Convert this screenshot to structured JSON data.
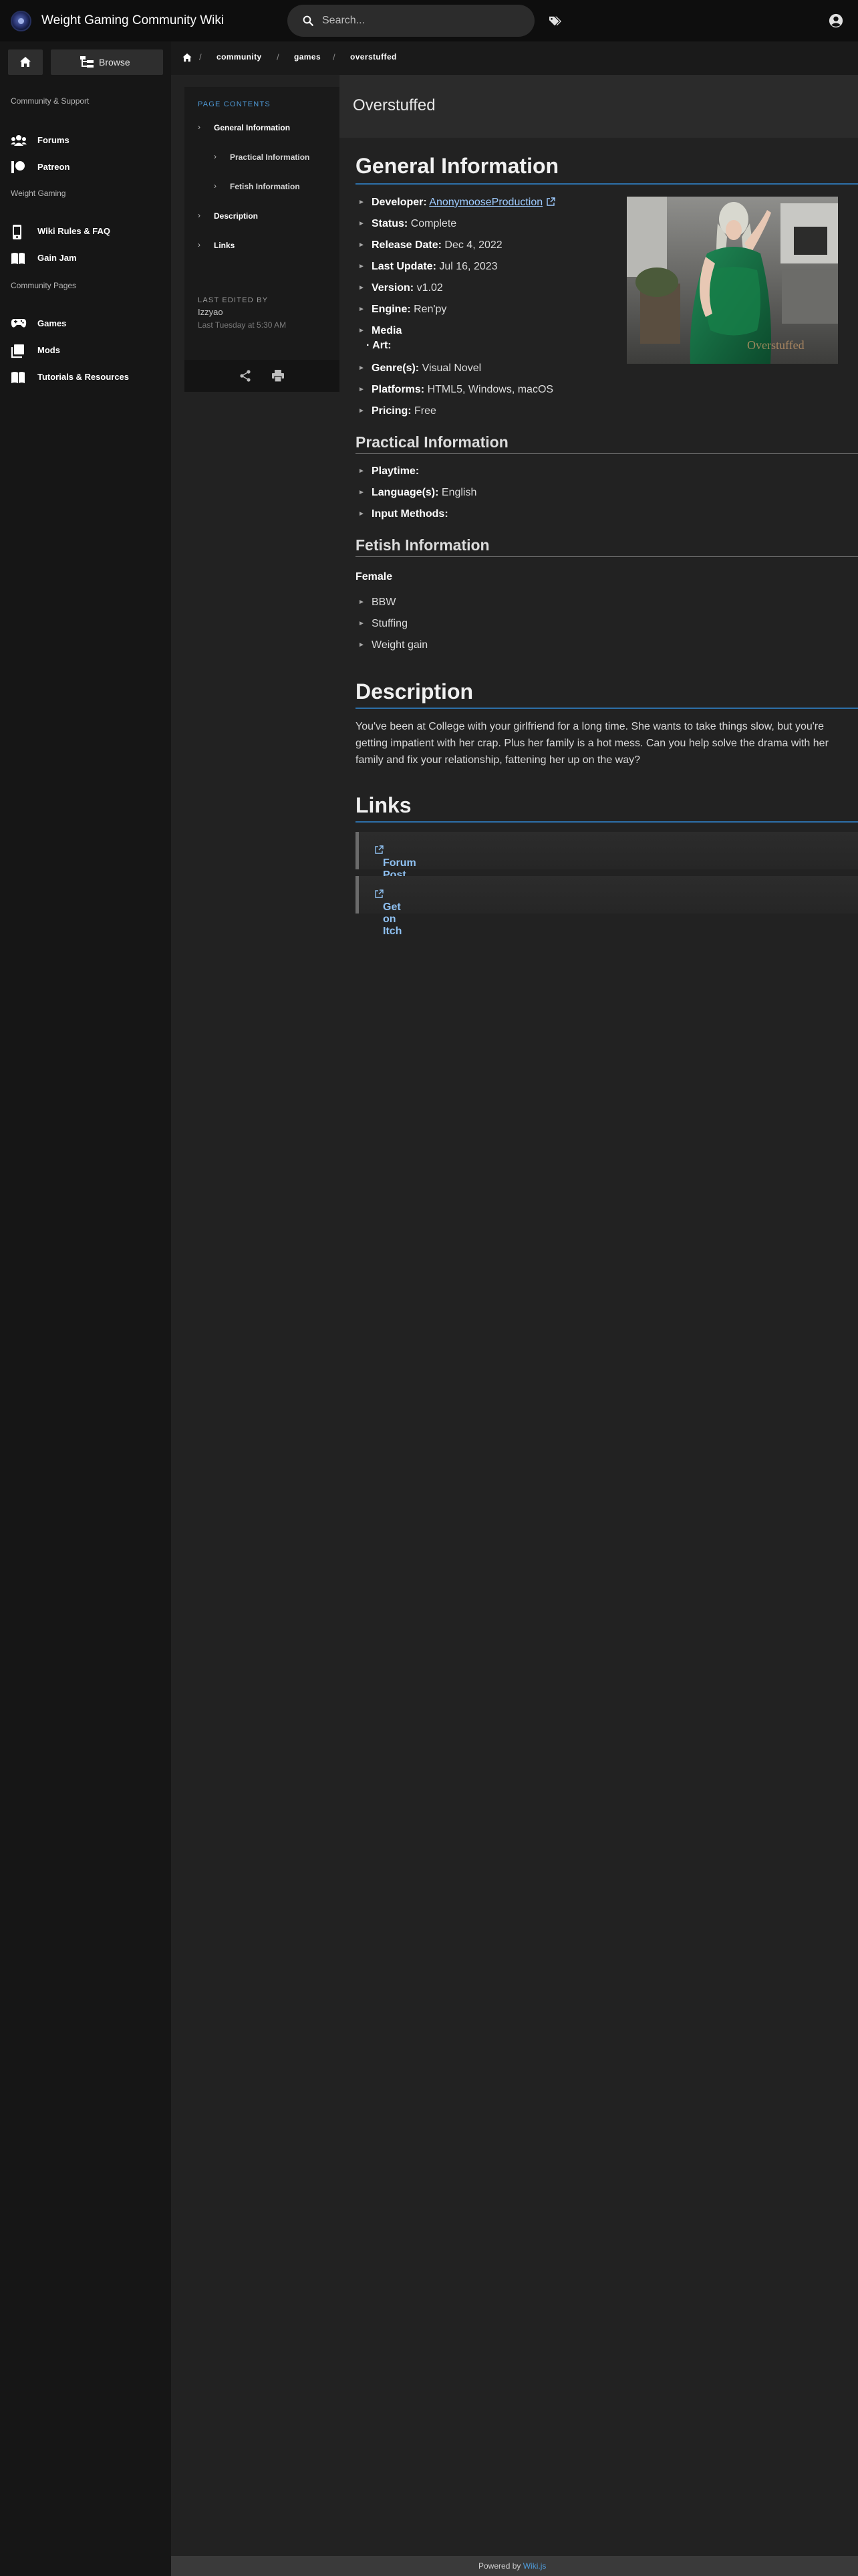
{
  "header": {
    "site_title": "Weight Gaming Community Wiki",
    "search_placeholder": "Search..."
  },
  "sidebar": {
    "browse_label": "Browse",
    "section_community": "Community & Support",
    "forums": "Forums",
    "patreon": "Patreon",
    "section_weight_gaming": "Weight Gaming",
    "rules": "Wiki Rules & FAQ",
    "gain_jam": "Gain Jam",
    "section_pages": "Community Pages",
    "games": "Games",
    "mods": "Mods",
    "tutorials": "Tutorials & Resources"
  },
  "breadcrumb": [
    "community",
    "games",
    "overstuffed"
  ],
  "page": {
    "title": "Overstuffed"
  },
  "toc": {
    "header": "PAGE CONTENTS",
    "items": [
      {
        "label": "General Information"
      },
      {
        "label": "Practical Information"
      },
      {
        "label": "Fetish Information"
      },
      {
        "label": "Description"
      },
      {
        "label": "Links"
      }
    ],
    "edited_header": "LAST EDITED BY",
    "edited_by": "Izzyao",
    "edited_date": "Last Tuesday at 5:30 AM"
  },
  "general": {
    "heading": "General Information",
    "developer_key": "Developer:",
    "developer_val": "AnonymooseProduction",
    "status_key": "Status:",
    "status_val": "Complete",
    "release_key": "Release Date:",
    "release_val": "Dec 4, 2022",
    "update_key": "Last Update:",
    "update_val": "Jul 16, 2023",
    "version_key": "Version:",
    "version_val": "v1.02",
    "engine_key": "Engine:",
    "engine_val": "Ren'py",
    "media_key": "Media",
    "art_key": "· Art:",
    "genre_key": "Genre(s):",
    "genre_val": "Visual Novel",
    "platforms_key": "Platforms:",
    "platforms_val": "HTML5, Windows, macOS",
    "pricing_key": "Pricing:",
    "pricing_val": "Free",
    "cover_watermark": "Overstuffed"
  },
  "practical": {
    "heading": "Practical Information",
    "playtime_key": "Playtime:",
    "language_key": "Language(s):",
    "language_val": "English",
    "input_key": "Input Methods:"
  },
  "fetish": {
    "heading": "Fetish Information",
    "group": "Female",
    "items": [
      "BBW",
      "Stuffing",
      "Weight gain"
    ]
  },
  "description": {
    "heading": "Description",
    "text": "You've been at College with your girlfriend for a long time. She wants to take things slow, but you're getting impatient with her crap. Plus her family is a hot mess. Can you help solve the drama with her family and fix your relationship, fattening her up on the way?"
  },
  "links": {
    "heading": "Links",
    "items": [
      "Forum Post",
      "Get on Itch"
    ]
  },
  "footer": {
    "prefix": "Powered by",
    "link": "Wiki.js"
  }
}
